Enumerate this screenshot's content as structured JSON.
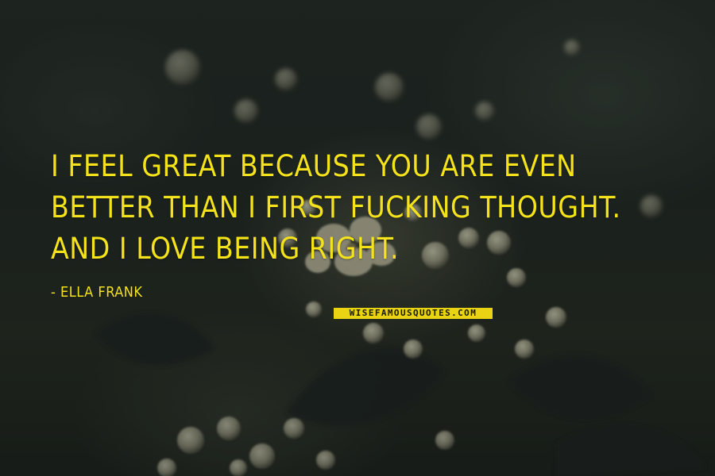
{
  "quote": {
    "text": "I FEEL GREAT BECAUSE YOU ARE EVEN BETTER THAN I FIRST FUCKING THOUGHT. AND I LOVE BEING RIGHT.",
    "author": "- ELLA FRANK"
  },
  "watermark": {
    "text": "WISEFAMOUSQUOTES.COM"
  },
  "colors": {
    "text": "#f4e21b",
    "watermark_bg": "#e9d312",
    "background": "#1f2622"
  }
}
